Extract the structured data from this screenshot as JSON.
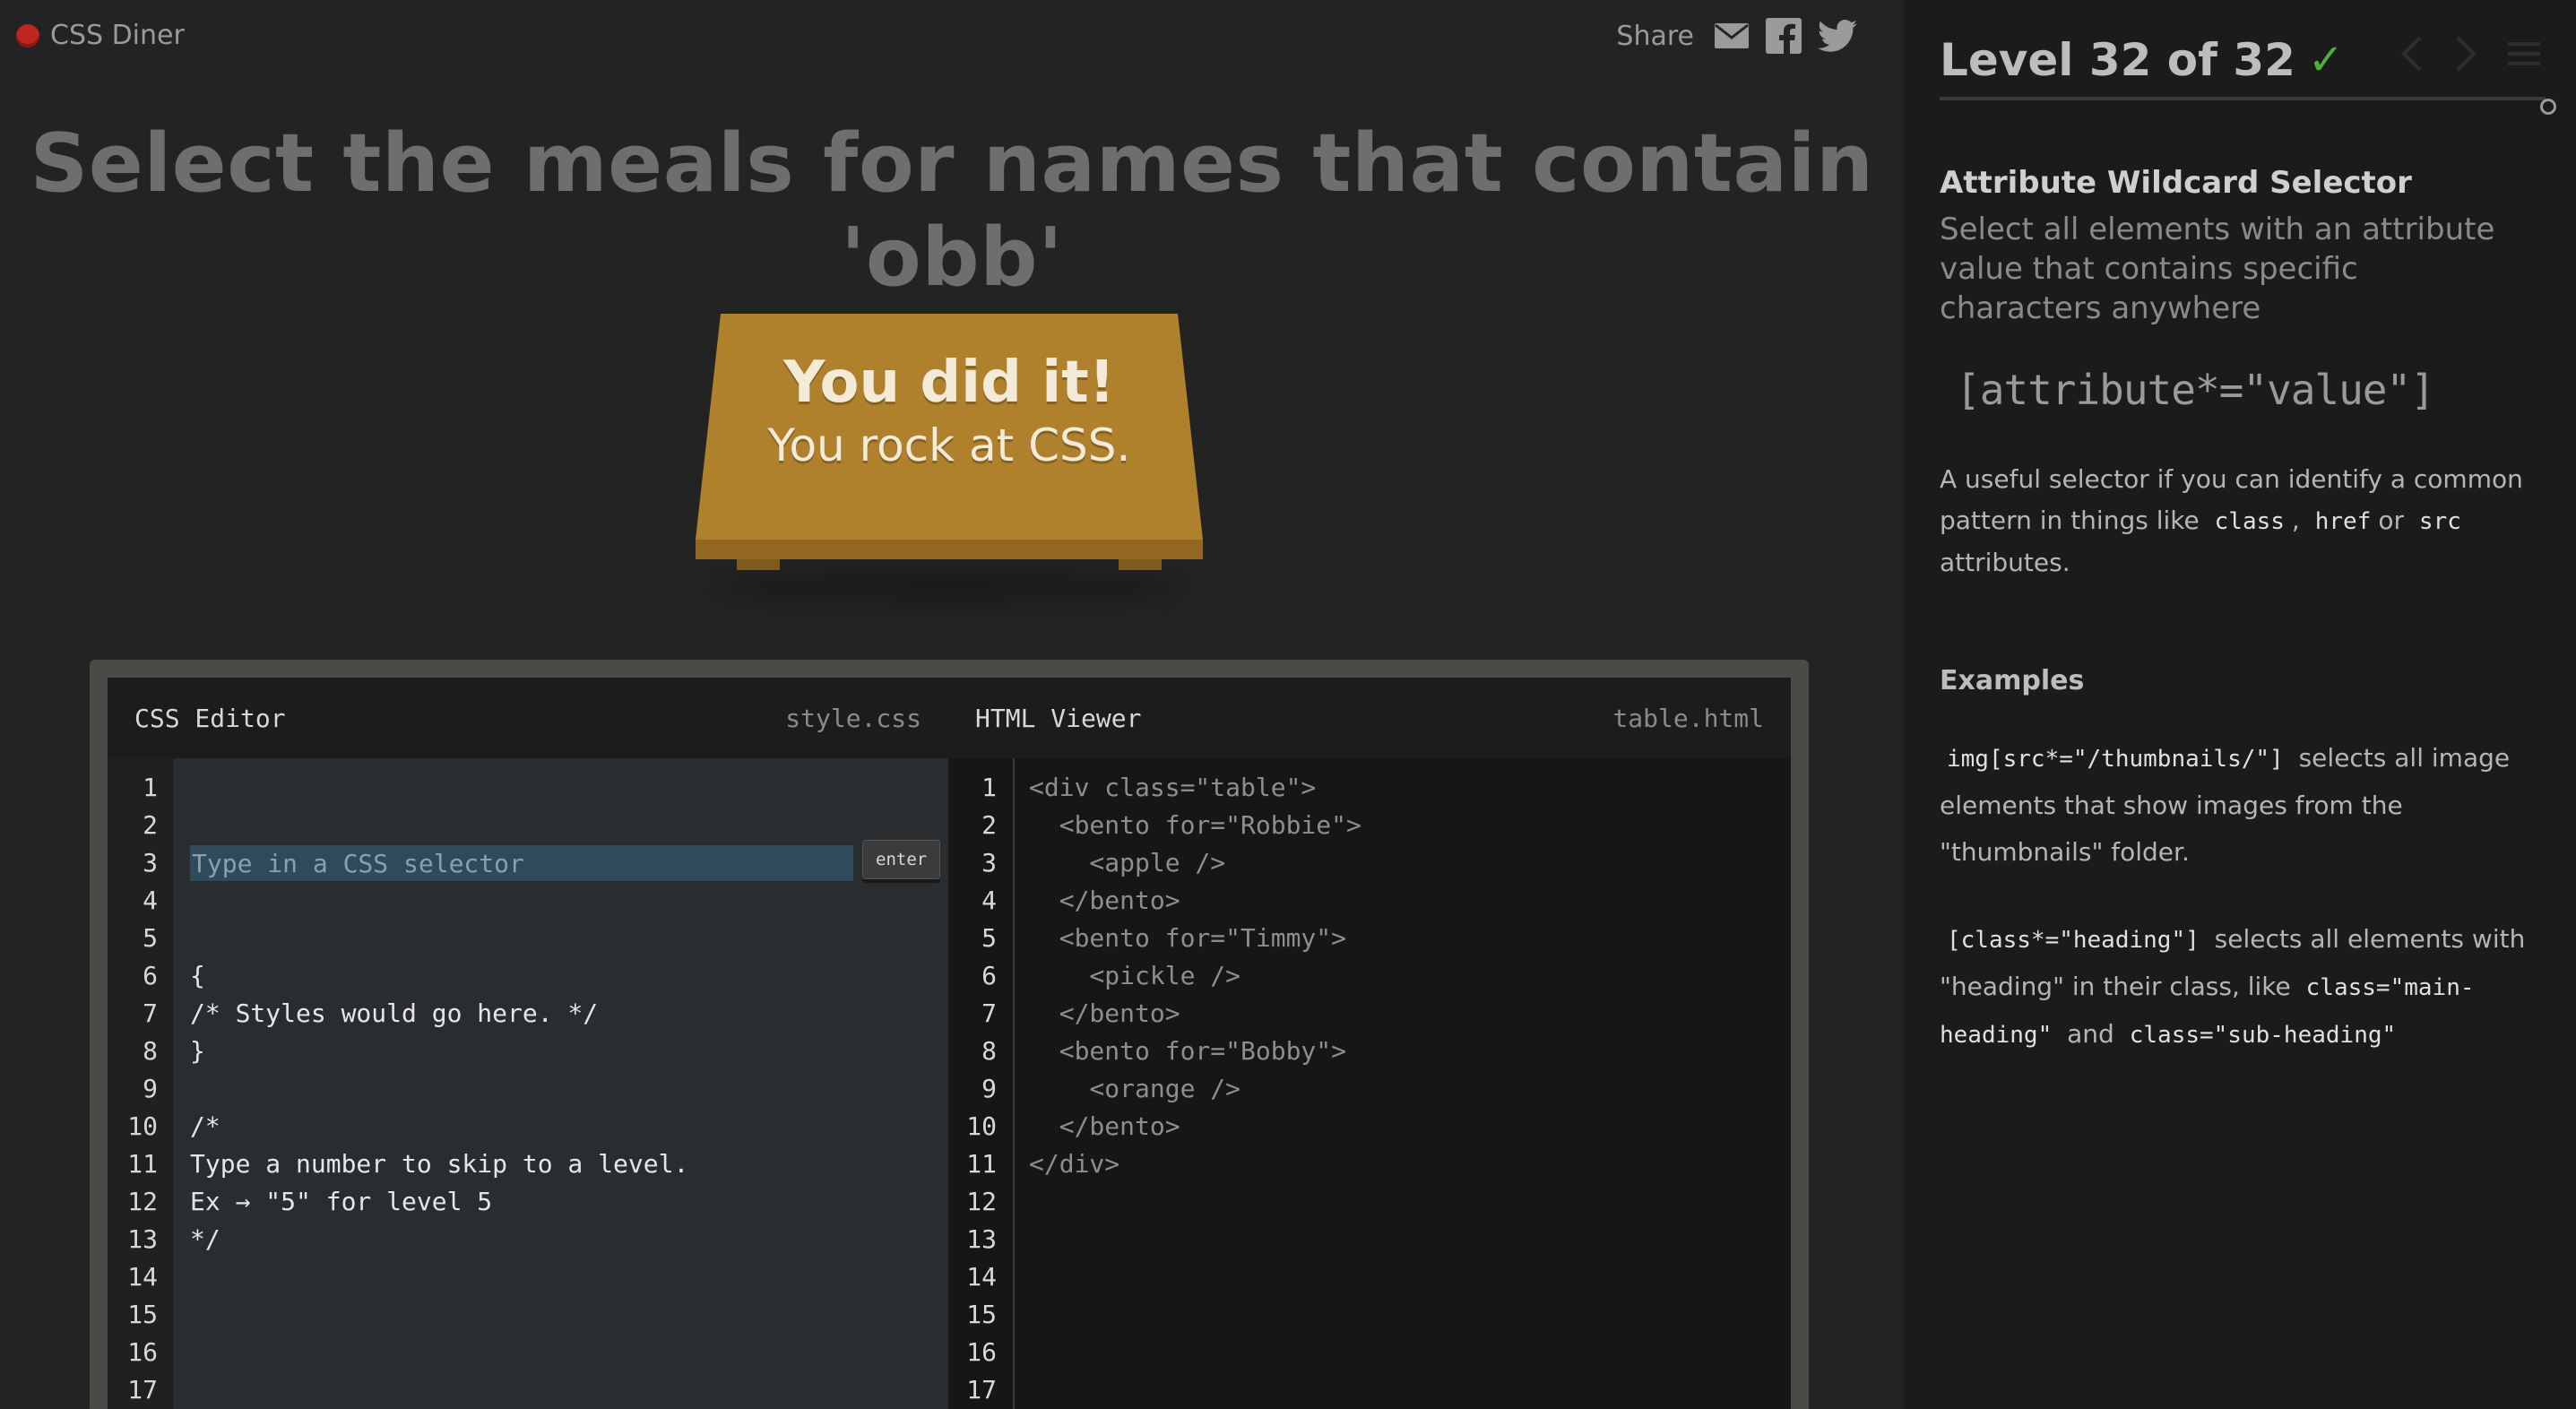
{
  "app": {
    "title": "CSS Diner"
  },
  "share": {
    "label": "Share"
  },
  "instruction": "Select the meals for names that contain 'obb'",
  "table_message": {
    "line1": "You did it!",
    "line2": "You rock at CSS."
  },
  "css_editor": {
    "title": "CSS Editor",
    "file": "style.css",
    "input_placeholder": "Type in a CSS selector",
    "enter_label": "enter",
    "line_numbers": [
      "1",
      "2",
      "3",
      "4",
      "5",
      "6",
      "7",
      "8",
      "9",
      "10",
      "11",
      "12",
      "13",
      "14",
      "15",
      "16",
      "17"
    ],
    "lines": [
      "{",
      "/* Styles would go here. */",
      "}",
      "",
      "/*",
      "Type a number to skip to a level.",
      "Ex → \"5\" for level 5",
      "*/"
    ]
  },
  "html_viewer": {
    "title": "HTML Viewer",
    "file": "table.html",
    "line_numbers": [
      "1",
      "2",
      "3",
      "4",
      "5",
      "6",
      "7",
      "8",
      "9",
      "10",
      "11",
      "12",
      "13",
      "14",
      "15",
      "16",
      "17"
    ],
    "lines": [
      "<div class=\"table\">",
      "  <bento for=\"Robbie\">",
      "    <apple />",
      "  </bento>",
      "  <bento for=\"Timmy\">",
      "    <pickle />",
      "  </bento>",
      "  <bento for=\"Bobby\">",
      "    <orange />",
      "  </bento>",
      "</div>"
    ]
  },
  "sidebar": {
    "level": "Level 32 of 32",
    "completed": true,
    "progress": 1.0,
    "selector_name": "Attribute Wildcard Selector",
    "selector_title": "Select all elements with an attribute value that contains specific characters anywhere",
    "syntax": "[attribute*=\"value\"]",
    "hint": {
      "before": "A useful selector if you can identify a common pattern in things like",
      "code1": "class",
      "sep1": ",",
      "code2": "href",
      "sep2": "or",
      "code3": "src",
      "after": "attributes."
    },
    "examples_heading": "Examples",
    "example1": {
      "code": "img[src*=\"/thumbnails/\"]",
      "text": "selects all image elements that show images from the \"thumbnails\" folder."
    },
    "example2": {
      "code": "[class*=\"heading\"]",
      "text1": "selects all elements with \"heading\" in their class, like",
      "code2": "class=\"main-heading\"",
      "and": "and",
      "code3": "class=\"sub-heading\""
    }
  },
  "colors": {
    "accent_check": "#4caf3a",
    "table": "#b0812d",
    "logo_dot": "#c1251f"
  }
}
